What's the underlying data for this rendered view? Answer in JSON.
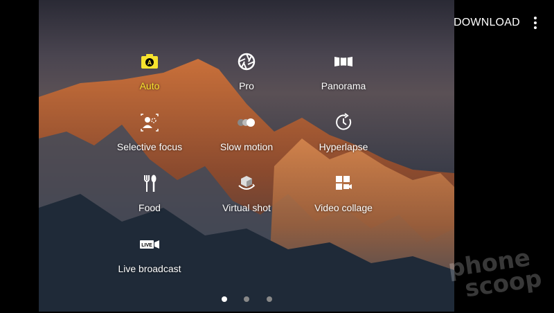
{
  "top_bar": {
    "download_label": "DOWNLOAD"
  },
  "modes": [
    {
      "label": "Auto",
      "icon": "camera-auto-icon",
      "active": true
    },
    {
      "label": "Pro",
      "icon": "aperture-icon",
      "active": false
    },
    {
      "label": "Panorama",
      "icon": "panorama-icon",
      "active": false
    },
    {
      "label": "Selective focus",
      "icon": "selective-focus-icon",
      "active": false
    },
    {
      "label": "Slow motion",
      "icon": "slow-motion-icon",
      "active": false
    },
    {
      "label": "Hyperlapse",
      "icon": "hyperlapse-icon",
      "active": false
    },
    {
      "label": "Food",
      "icon": "food-icon",
      "active": false
    },
    {
      "label": "Virtual shot",
      "icon": "virtual-shot-icon",
      "active": false
    },
    {
      "label": "Video collage",
      "icon": "video-collage-icon",
      "active": false
    },
    {
      "label": "Live broadcast",
      "icon": "live-broadcast-icon",
      "active": false
    }
  ],
  "pagination": {
    "current": 1,
    "total": 3
  },
  "watermark": {
    "line1": "phone",
    "line2": "scoop"
  },
  "colors": {
    "active": "#f7e32e",
    "label": "#ffffff",
    "background": "#000000"
  }
}
